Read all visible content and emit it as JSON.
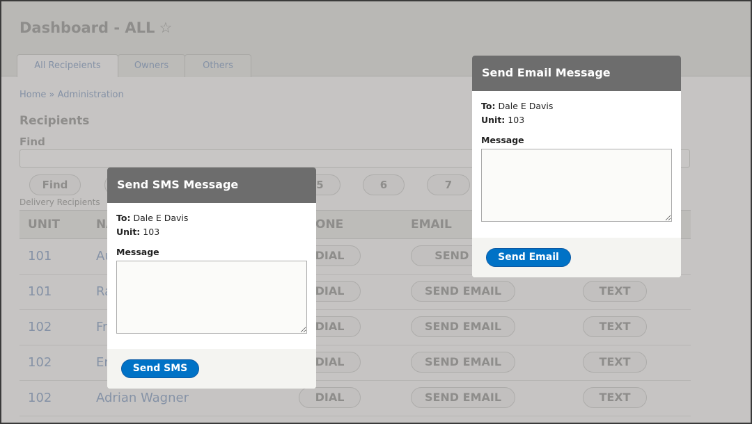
{
  "header": {
    "title": "Dashboard - ALL",
    "star_icon": "star-outline-icon"
  },
  "tabs": [
    {
      "label": "All Recipeients",
      "active": true
    },
    {
      "label": "Owners"
    },
    {
      "label": "Others"
    }
  ],
  "breadcrumb": "Home » Administration",
  "section_title": "Recipients",
  "find": {
    "label": "Find",
    "value": "",
    "button": "Find"
  },
  "pagination": [
    "5",
    "6",
    "7"
  ],
  "table": {
    "caption": "Delivery Recipients",
    "headers": [
      "UNIT",
      "NA",
      "ONE",
      "EMAIL"
    ],
    "rows": [
      {
        "unit": "101",
        "name": "Au",
        "dial": "DIAL",
        "email": "SEND EM",
        "text": ""
      },
      {
        "unit": "101",
        "name": "Ra",
        "dial": "DIAL",
        "email": "SEND EMAIL",
        "text": "TEXT"
      },
      {
        "unit": "102",
        "name": "Fr",
        "dial": "DIAL",
        "email": "SEND EMAIL",
        "text": "TEXT"
      },
      {
        "unit": "102",
        "name": "Er",
        "dial": "DIAL",
        "email": "SEND EMAIL",
        "text": "TEXT"
      },
      {
        "unit": "102",
        "name": "Adrian Wagner",
        "dial": "DIAL",
        "email": "SEND EMAIL",
        "text": "TEXT"
      }
    ]
  },
  "sms_modal": {
    "title": "Send SMS Message",
    "to_label": "To:",
    "to": "Dale E Davis",
    "unit_label": "Unit:",
    "unit": "103",
    "message_label": "Message",
    "message": "",
    "button": "Send SMS"
  },
  "email_modal": {
    "title": "Send Email Message",
    "to_label": "To:",
    "to": "Dale E Davis",
    "unit_label": "Unit:",
    "unit": "103",
    "message_label": "Message",
    "message": "",
    "button": "Send Email"
  },
  "colors": {
    "accent": "#0072c6",
    "modal_header": "#6d6d6d"
  }
}
